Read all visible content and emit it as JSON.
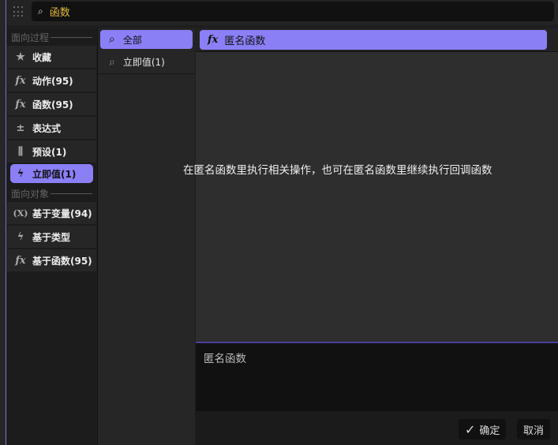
{
  "search": {
    "value": "函数"
  },
  "left": {
    "sections": [
      {
        "label": "面向过程",
        "items": [
          {
            "icon": "star-icon",
            "glyph": "★",
            "label": "收藏"
          },
          {
            "icon": "function-icon",
            "glyph": "fx",
            "label": "动作(95)"
          },
          {
            "icon": "function-icon",
            "glyph": "fx",
            "label": "函数(95)"
          },
          {
            "icon": "operators-icon",
            "glyph": "±",
            "label": "表达式"
          },
          {
            "icon": "sliders-icon",
            "glyph": "⫼",
            "label": "预设(1)"
          },
          {
            "icon": "lightning-icon",
            "glyph": "ϟ",
            "label": "立即值(1)",
            "active": true
          }
        ]
      },
      {
        "label": "面向对象",
        "items": [
          {
            "icon": "variable-icon",
            "glyph": "(X)",
            "label": "基于变量(94)"
          },
          {
            "icon": "lightning-icon",
            "glyph": "ϟ",
            "label": "基于类型"
          },
          {
            "icon": "function-icon",
            "glyph": "fx",
            "label": "基于函数(95)"
          }
        ]
      }
    ]
  },
  "middle": {
    "items": [
      {
        "label": "全部",
        "active": true
      },
      {
        "label": "立即值(1)"
      }
    ]
  },
  "right": {
    "selected": {
      "glyph": "fx",
      "label": "匿名函数"
    },
    "description": "在匿名函数里执行相关操作，也可在匿名函数里继续执行回调函数",
    "text_value": "匿名函数"
  },
  "footer": {
    "confirm": "确定",
    "cancel": "取消"
  },
  "colors": {
    "accent": "#8a7ff5",
    "search_text": "#e2b93b"
  }
}
